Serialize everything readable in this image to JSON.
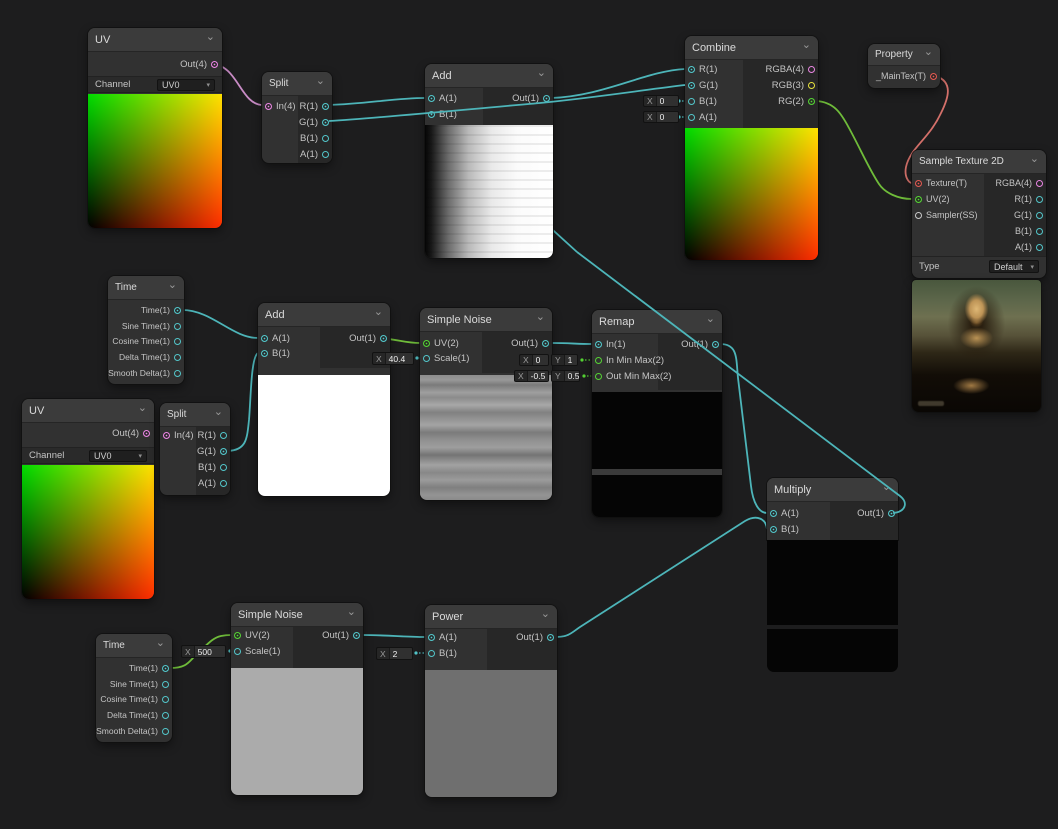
{
  "colors": {
    "background": "#1d1d1e",
    "node_body": "#313131",
    "node_title_bar": "#3b3b3b",
    "output_panel": "#272727",
    "wire_vector1": "#4db5b9",
    "wire_vector2": "#6fbc3a",
    "wire_vector4": "#c98cc6",
    "wire_texture": "#d4706a",
    "port_vector1": "#53c6ca",
    "port_vector2": "#55d334",
    "port_vector3": "#e8e23c",
    "port_vector4": "#ea86e3",
    "port_texture": "#e25a52",
    "port_sampler": "#c9c9c9"
  },
  "nodes": {
    "uv1": {
      "title": "UV",
      "out": "Out(4)",
      "channel_label": "Channel",
      "channel_value": "UV0"
    },
    "split1": {
      "title": "Split",
      "in": "In(4)",
      "r": "R(1)",
      "g": "G(1)",
      "b": "B(1)",
      "a": "A(1)"
    },
    "add1": {
      "title": "Add",
      "a": "A(1)",
      "b": "B(1)",
      "out": "Out(1)"
    },
    "combine": {
      "title": "Combine",
      "in_r": "R(1)",
      "in_g": "G(1)",
      "in_b": "B(1)",
      "in_a": "A(1)",
      "out_rgba": "RGBA(4)",
      "out_rgb": "RGB(3)",
      "out_rg": "RG(2)",
      "field_b_label": "X",
      "field_b_value": "0",
      "field_a_label": "X",
      "field_a_value": "0"
    },
    "property1": {
      "title": "Property",
      "port": "_MainTex(T)"
    },
    "sample": {
      "title": "Sample Texture 2D",
      "in_texture": "Texture(T)",
      "in_uv": "UV(2)",
      "in_sampler": "Sampler(SS)",
      "out_rgba": "RGBA(4)",
      "out_r": "R(1)",
      "out_g": "G(1)",
      "out_b": "B(1)",
      "out_a": "A(1)",
      "type_label": "Type",
      "type_value": "Default"
    },
    "time1": {
      "title": "Time",
      "time": "Time(1)",
      "sine": "Sine Time(1)",
      "cosine": "Cosine Time(1)",
      "delta": "Delta Time(1)",
      "smooth": "Smooth Delta(1)"
    },
    "add2": {
      "title": "Add",
      "a": "A(1)",
      "b": "B(1)",
      "out": "Out(1)"
    },
    "noise1": {
      "title": "Simple Noise",
      "uv": "UV(2)",
      "scale": "Scale(1)",
      "out": "Out(1)",
      "scale_label": "X",
      "scale_value": "40.4"
    },
    "remap": {
      "title": "Remap",
      "in": "In(1)",
      "in_min_max": "In Min Max(2)",
      "out_min_max": "Out Min Max(2)",
      "out": "Out(1)",
      "in_x_label": "X",
      "in_x_value": "0",
      "in_y_label": "Y",
      "in_y_value": "1",
      "out_x_label": "X",
      "out_x_value": "-0.5",
      "out_y_label": "Y",
      "out_y_value": "0.5"
    },
    "uv2": {
      "title": "UV",
      "out": "Out(4)",
      "channel_label": "Channel",
      "channel_value": "UV0"
    },
    "split2": {
      "title": "Split",
      "in": "In(4)",
      "r": "R(1)",
      "g": "G(1)",
      "b": "B(1)",
      "a": "A(1)"
    },
    "multiply": {
      "title": "Multiply",
      "a": "A(1)",
      "b": "B(1)",
      "out": "Out(1)"
    },
    "noise2": {
      "title": "Simple Noise",
      "uv": "UV(2)",
      "scale": "Scale(1)",
      "out": "Out(1)",
      "scale_label": "X",
      "scale_value": "500"
    },
    "time2": {
      "title": "Time",
      "time": "Time(1)",
      "sine": "Sine Time(1)",
      "cosine": "Cosine Time(1)",
      "delta": "Delta Time(1)",
      "smooth": "Smooth Delta(1)"
    },
    "power": {
      "title": "Power",
      "a": "A(1)",
      "b": "B(1)",
      "out": "Out(1)",
      "b_field_label": "X",
      "b_field_value": "2"
    }
  }
}
